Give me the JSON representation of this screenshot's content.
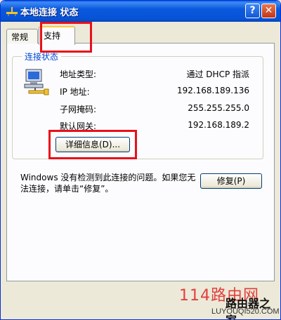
{
  "window": {
    "title": "本地连接 状态",
    "help_label": "?",
    "close_label": "✕"
  },
  "tabs": [
    {
      "label": "常规",
      "active": false
    },
    {
      "label": "支持",
      "active": true
    }
  ],
  "connection_status": {
    "group_label": "连接状态",
    "fields": [
      {
        "label": "地址类型:",
        "value": "通过 DHCP 指派"
      },
      {
        "label": "IP 地址:",
        "value": "192.168.189.136"
      },
      {
        "label": "子网掩码:",
        "value": "255.255.255.0"
      },
      {
        "label": "默认网关:",
        "value": "192.168.189.2"
      }
    ],
    "details_button": "详细信息(D)..."
  },
  "repair": {
    "message": "Windows 没有检测到此连接的问题。如果您无法连接，请单击“修复”。",
    "button": "修复(P)"
  },
  "watermark": {
    "main": "114路由网",
    "sub": "LUYOUQI520.COM",
    "overlay": "路由器之家"
  },
  "colors": {
    "titlebar": "#0653d6",
    "highlight": "#e8101a",
    "group_label": "#0046d5"
  }
}
